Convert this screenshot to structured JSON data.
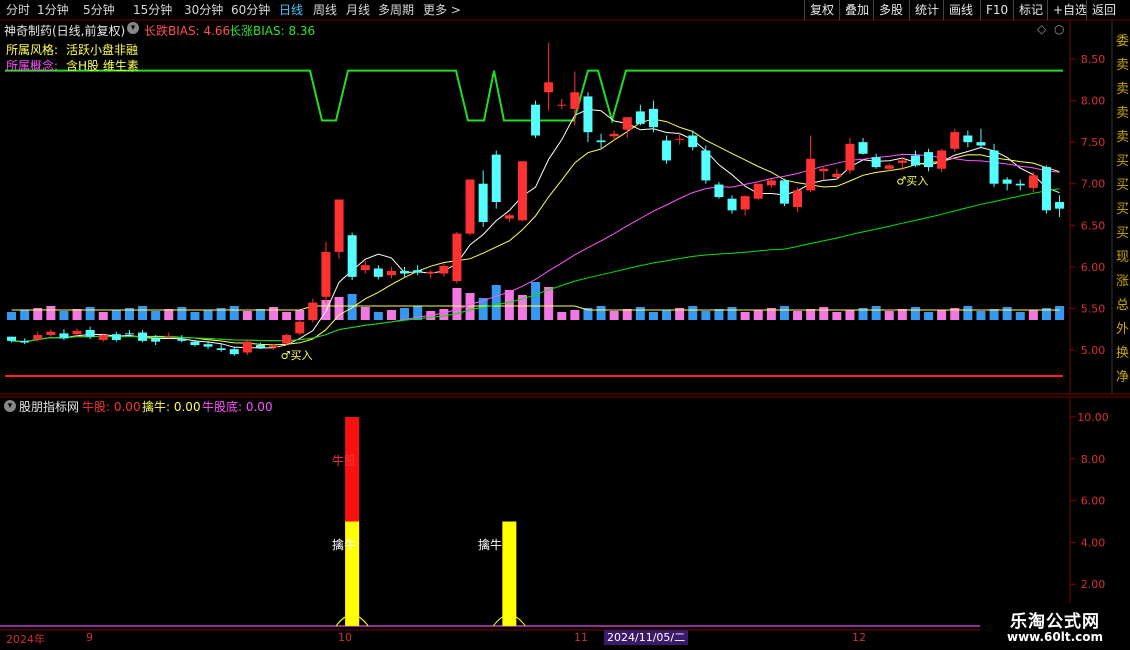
{
  "toolbar": {
    "periods": [
      "分时",
      "1分钟",
      "5分钟",
      "15分钟",
      "30分钟",
      "60分钟",
      "日线",
      "周线",
      "月线",
      "多周期",
      "更多 >"
    ],
    "active_period": "日线",
    "right_buttons": [
      "复权",
      "叠加",
      "多股",
      "统计",
      "画线",
      "F10",
      "标记",
      "+自选",
      "返回"
    ]
  },
  "main_panel": {
    "title": "神奇制药(日线,前复权)",
    "bias_down_label": "长跌BIAS: 4.66",
    "bias_up_label": "长涨BIAS: 8.36",
    "style_label": "所属风格:",
    "style_value": "活跃小盘非融",
    "concept_label": "所属概念:",
    "concept_value": "含H股 维生素",
    "buy_signal_text": "买入",
    "price_axis": [
      "8.50",
      "8.00",
      "7.50",
      "7.00",
      "6.50",
      "6.00",
      "5.50",
      "5.00"
    ]
  },
  "indicator_panel": {
    "title": "股朋指标网",
    "niu_gu": "牛股: 0.00",
    "qin_niu": "擒牛: 0.00",
    "niu_gu_di": "牛股底: 0.00",
    "marker_niu_gu": "牛股",
    "marker_qin_niu": "擒牛",
    "axis": [
      "10.00",
      "8.00",
      "6.00",
      "4.00",
      "2.00"
    ]
  },
  "xaxis": {
    "labels": [
      "2024年",
      "9",
      "10",
      "11",
      "12"
    ],
    "highlight_date": "2024/11/05/二"
  },
  "watermark": {
    "title": "乐淘公式网",
    "url": "www.60lt.com"
  },
  "right_sidebar": [
    "委",
    "卖",
    "卖",
    "卖",
    "卖",
    "买",
    "买",
    "买",
    "买",
    "现",
    "涨",
    "总",
    "外",
    "换",
    "净"
  ],
  "colors": {
    "up": "#ff3232",
    "down": "#54ffff",
    "ma_white": "#ffffff",
    "ma_yellow": "#ffff54",
    "ma_magenta": "#ff54ff",
    "ma_green": "#00e600",
    "signal_green": "#22dd22",
    "axis_red": "#8a0000",
    "active_blue": "#3fc8ff"
  },
  "chart_data": [
    {
      "type": "candlestick",
      "title": "神奇制药(日线,前复权)",
      "ylim": [
        4.6,
        8.9
      ],
      "yticks": [
        5.0,
        5.5,
        6.0,
        6.5,
        7.0,
        7.5,
        8.0,
        8.5
      ],
      "candles": [
        [
          5.16,
          5.16,
          5.09,
          5.11
        ],
        [
          5.11,
          5.14,
          5.07,
          5.09
        ],
        [
          5.13,
          5.22,
          5.1,
          5.18
        ],
        [
          5.18,
          5.25,
          5.16,
          5.22
        ],
        [
          5.2,
          5.25,
          5.12,
          5.14
        ],
        [
          5.19,
          5.26,
          5.16,
          5.23
        ],
        [
          5.24,
          5.28,
          5.13,
          5.16
        ],
        [
          5.12,
          5.2,
          5.1,
          5.18
        ],
        [
          5.19,
          5.22,
          5.1,
          5.12
        ],
        [
          5.2,
          5.24,
          5.16,
          5.19
        ],
        [
          5.21,
          5.24,
          5.09,
          5.11
        ],
        [
          5.14,
          5.18,
          5.06,
          5.1
        ],
        [
          5.16,
          5.21,
          5.14,
          5.17
        ],
        [
          5.13,
          5.18,
          5.09,
          5.11
        ],
        [
          5.1,
          5.12,
          5.04,
          5.06
        ],
        [
          5.07,
          5.11,
          5.01,
          5.04
        ],
        [
          5.02,
          5.08,
          4.98,
          5.0
        ],
        [
          5.01,
          5.04,
          4.93,
          4.95
        ],
        [
          4.97,
          5.12,
          4.94,
          5.1
        ],
        [
          5.06,
          5.09,
          5.01,
          5.03
        ],
        [
          5.03,
          5.07,
          5.0,
          5.05
        ],
        [
          5.08,
          5.2,
          5.06,
          5.18
        ],
        [
          5.2,
          5.36,
          5.18,
          5.34
        ],
        [
          5.36,
          5.62,
          5.33,
          5.57
        ],
        [
          5.64,
          6.3,
          5.56,
          6.18
        ],
        [
          6.18,
          6.81,
          6.1,
          6.81
        ],
        [
          6.38,
          6.41,
          5.84,
          5.88
        ],
        [
          5.96,
          6.07,
          5.92,
          6.02
        ],
        [
          5.98,
          6.02,
          5.85,
          5.88
        ],
        [
          5.9,
          6.0,
          5.86,
          5.95
        ],
        [
          5.95,
          6.0,
          5.88,
          5.92
        ],
        [
          5.96,
          6.02,
          5.9,
          5.93
        ],
        [
          5.92,
          5.96,
          5.86,
          5.94
        ],
        [
          5.92,
          6.04,
          5.88,
          6.01
        ],
        [
          5.83,
          6.42,
          5.8,
          6.4
        ],
        [
          6.4,
          7.05,
          6.38,
          7.05
        ],
        [
          7.0,
          7.16,
          6.48,
          6.54
        ],
        [
          7.35,
          7.4,
          6.7,
          6.78
        ],
        [
          6.58,
          6.64,
          6.54,
          6.62
        ],
        [
          6.56,
          7.27,
          6.55,
          7.27
        ],
        [
          7.95,
          8.0,
          7.55,
          7.58
        ],
        [
          8.1,
          8.7,
          7.88,
          8.22
        ],
        [
          7.94,
          8.02,
          7.9,
          7.95
        ],
        [
          7.9,
          8.35,
          7.7,
          8.1
        ],
        [
          8.05,
          8.1,
          7.5,
          7.62
        ],
        [
          7.52,
          7.6,
          7.43,
          7.5
        ],
        [
          7.57,
          7.64,
          7.52,
          7.6
        ],
        [
          7.65,
          7.78,
          7.55,
          7.8
        ],
        [
          7.87,
          7.95,
          7.7,
          7.72
        ],
        [
          7.9,
          8.0,
          7.62,
          7.68
        ],
        [
          7.52,
          7.58,
          7.24,
          7.28
        ],
        [
          7.53,
          7.62,
          7.47,
          7.54
        ],
        [
          7.58,
          7.64,
          7.4,
          7.44
        ],
        [
          7.4,
          7.46,
          7.0,
          7.04
        ],
        [
          6.99,
          7.02,
          6.82,
          6.84
        ],
        [
          6.82,
          6.86,
          6.64,
          6.68
        ],
        [
          6.69,
          6.86,
          6.62,
          6.85
        ],
        [
          6.82,
          7.0,
          6.8,
          7.0
        ],
        [
          6.98,
          7.06,
          6.95,
          7.04
        ],
        [
          7.04,
          7.06,
          6.73,
          6.76
        ],
        [
          6.72,
          6.95,
          6.66,
          6.92
        ],
        [
          6.92,
          7.58,
          6.9,
          7.3
        ],
        [
          7.15,
          7.2,
          7.04,
          7.18
        ],
        [
          7.08,
          7.18,
          7.05,
          7.12
        ],
        [
          7.16,
          7.55,
          7.12,
          7.48
        ],
        [
          7.5,
          7.55,
          7.35,
          7.36
        ],
        [
          7.32,
          7.36,
          7.18,
          7.2
        ],
        [
          7.18,
          7.24,
          7.15,
          7.22
        ],
        [
          7.25,
          7.32,
          7.16,
          7.28
        ],
        [
          7.34,
          7.4,
          7.2,
          7.22
        ],
        [
          7.38,
          7.42,
          7.15,
          7.2
        ],
        [
          7.18,
          7.42,
          7.14,
          7.4
        ],
        [
          7.42,
          7.66,
          7.38,
          7.62
        ],
        [
          7.58,
          7.64,
          7.44,
          7.5
        ],
        [
          7.5,
          7.66,
          7.44,
          7.46
        ],
        [
          7.4,
          7.48,
          6.96,
          7.0
        ],
        [
          7.05,
          7.08,
          6.92,
          7.0
        ],
        [
          7.0,
          7.05,
          6.92,
          6.98
        ],
        [
          6.95,
          7.14,
          6.9,
          7.1
        ],
        [
          7.2,
          7.22,
          6.64,
          6.68
        ],
        [
          6.78,
          6.86,
          6.6,
          6.7
        ]
      ],
      "ma_lines": [
        "white",
        "yellow",
        "magenta",
        "green"
      ],
      "buy_signals": [
        21,
        68
      ]
    },
    {
      "type": "bar",
      "title": "股朋指标网",
      "ylim": [
        0,
        10.5
      ],
      "yticks": [
        2,
        4,
        6,
        8,
        10
      ],
      "series": [
        {
          "name": "牛股",
          "points": [
            {
              "index": 26,
              "value": 10.0
            }
          ]
        },
        {
          "name": "擒牛",
          "points": [
            {
              "index": 26,
              "value": 5.0
            },
            {
              "index": 38,
              "value": 5.0
            }
          ]
        }
      ]
    }
  ]
}
